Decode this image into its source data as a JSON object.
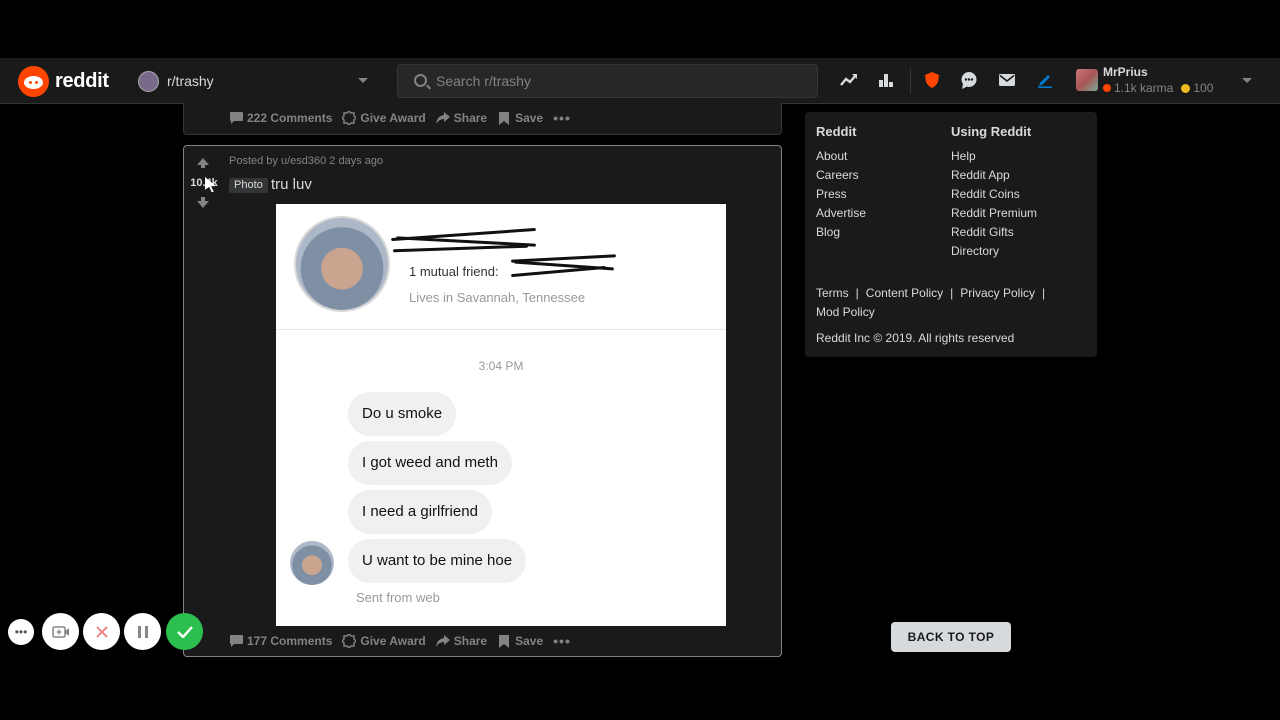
{
  "header": {
    "logo_text": "reddit",
    "subreddit": "r/trashy",
    "search_placeholder": "Search r/trashy",
    "user": {
      "name": "MrPrius",
      "karma": "1.1k karma",
      "coins": "100"
    },
    "icons": [
      "trending-icon",
      "stats-icon",
      "mod-shield-icon",
      "chat-icon",
      "mail-icon",
      "create-post-icon"
    ]
  },
  "prev_post": {
    "comments": "222 Comments",
    "give_award": "Give Award",
    "share": "Share",
    "save": "Save",
    "more": "•••"
  },
  "post": {
    "votes": "10.4k",
    "posted_by": "Posted by u/esd360 2 days ago",
    "flair": "Photo",
    "title": "tru luv",
    "comments": "177 Comments",
    "give_award": "Give Award",
    "share": "Share",
    "save": "Save",
    "more": "•••",
    "image": {
      "mutual": "1 mutual friend:",
      "lives": "Lives in Savannah, Tennessee",
      "time": "3:04 PM",
      "messages": [
        "Do u smoke",
        "I got weed and meth",
        "I need a girlfriend",
        "U want to be mine hoe"
      ],
      "sent_from": "Sent from web"
    }
  },
  "sidebar": {
    "reddit_heading": "Reddit",
    "reddit_links": [
      "About",
      "Careers",
      "Press",
      "Advertise",
      "Blog"
    ],
    "using_heading": "Using Reddit",
    "using_links": [
      "Help",
      "Reddit App",
      "Reddit Coins",
      "Reddit Premium",
      "Reddit Gifts",
      "Directory"
    ],
    "policies": {
      "terms": "Terms",
      "content": "Content Policy",
      "privacy": "Privacy Policy",
      "mod": "Mod Policy"
    },
    "copyright": "Reddit Inc © 2019. All rights reserved"
  },
  "back_to_top": "BACK TO TOP",
  "colors": {
    "brand": "#ff4500",
    "background": "#000000",
    "card": "#1a1a1b",
    "confirm": "#2bbf4f"
  }
}
